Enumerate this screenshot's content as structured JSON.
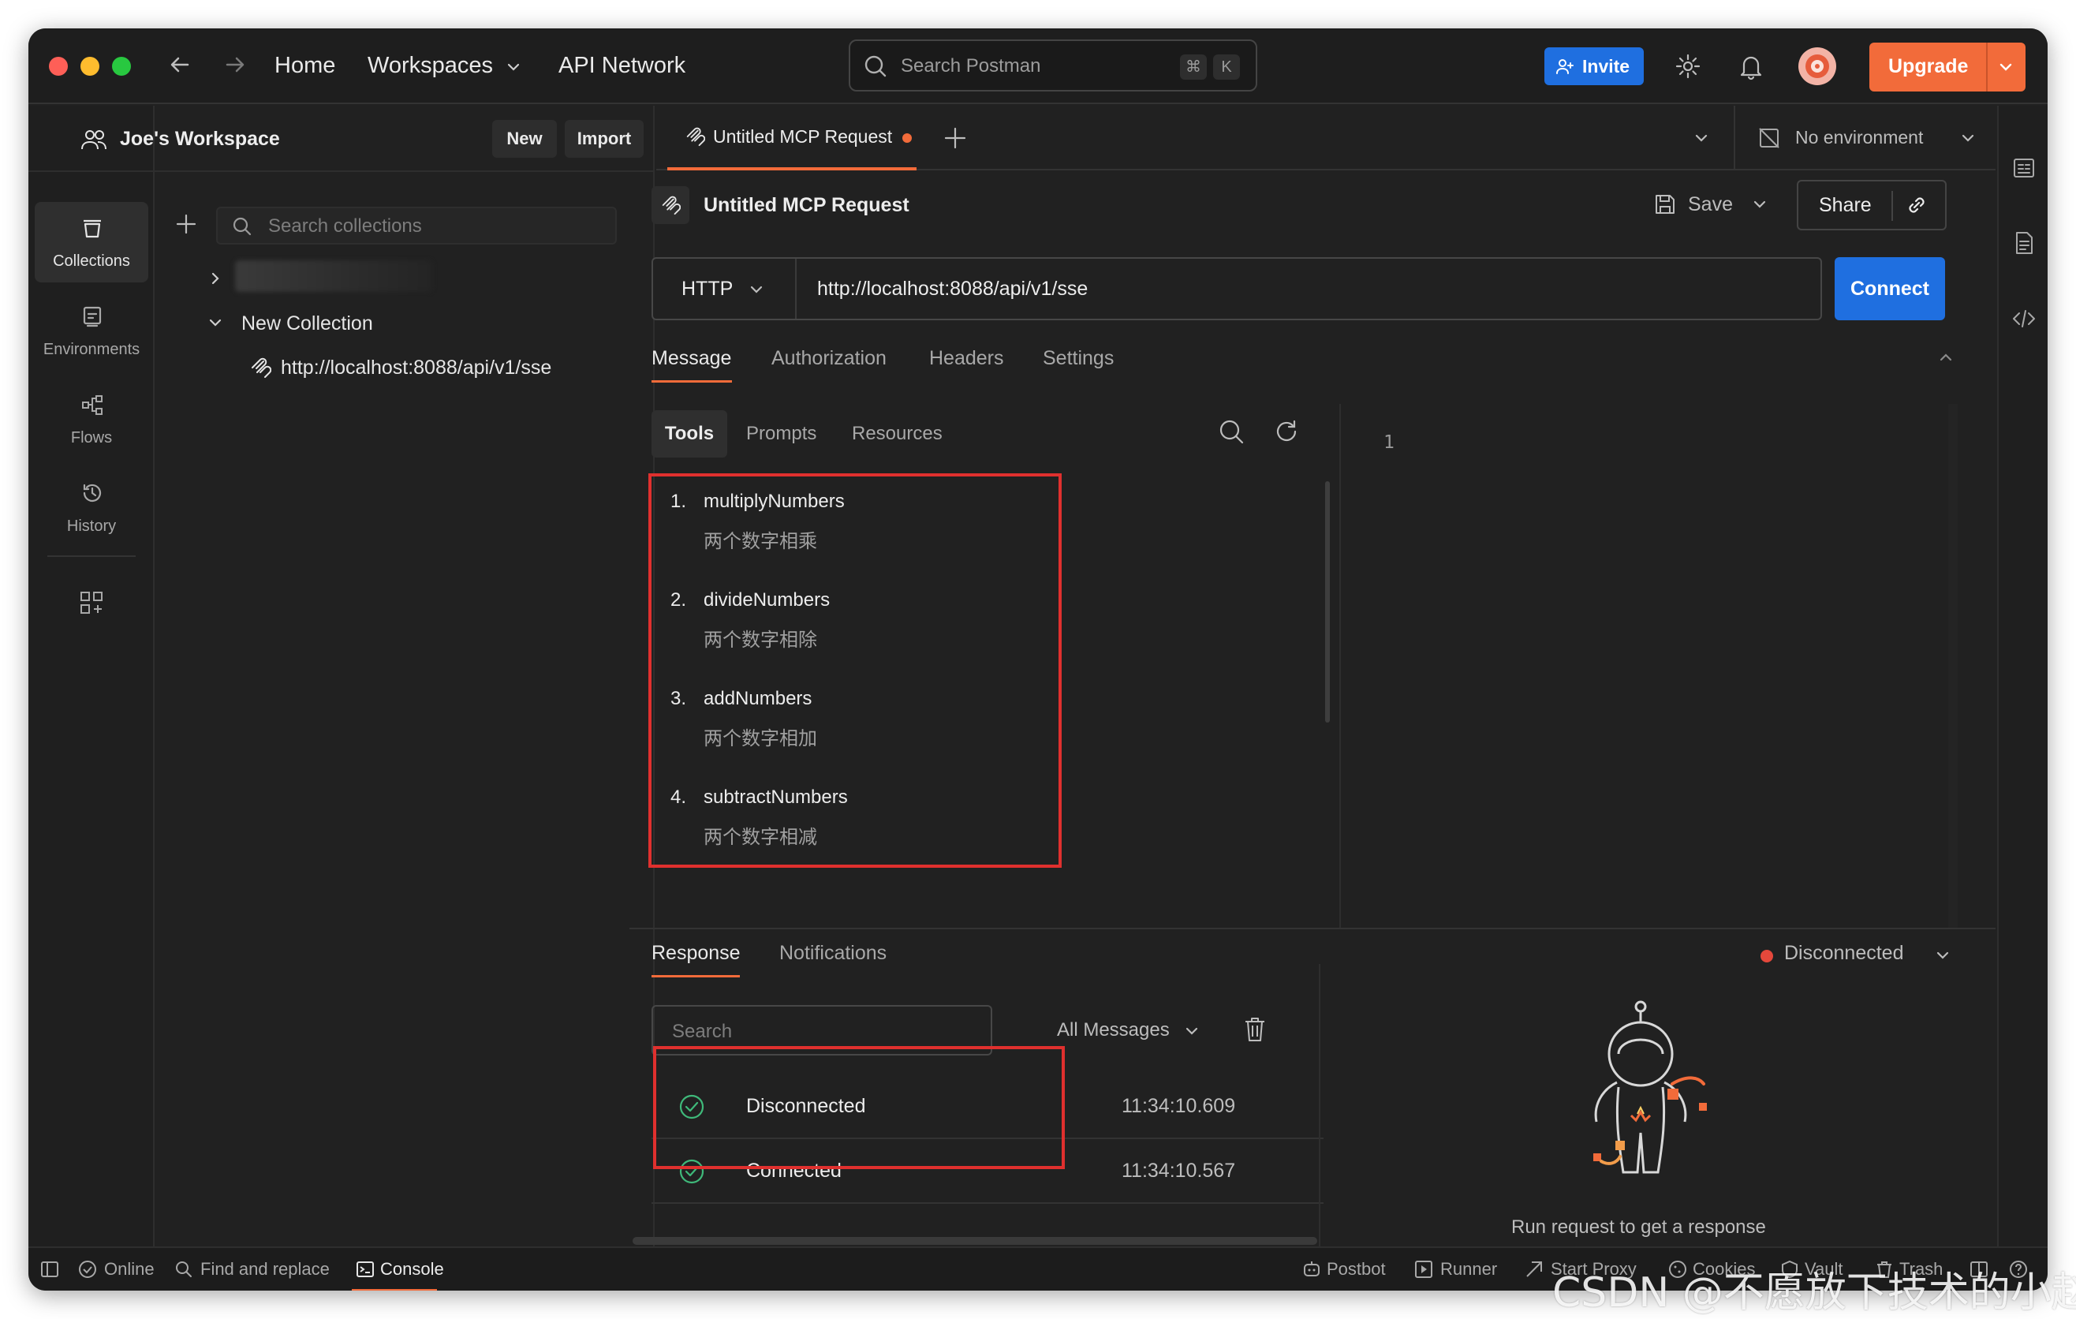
{
  "titlebar": {
    "home": "Home",
    "workspaces": "Workspaces",
    "api_network": "API Network",
    "search_placeholder": "Search Postman",
    "shortcut_cmd": "⌘",
    "shortcut_key": "K",
    "invite": "Invite",
    "upgrade": "Upgrade"
  },
  "rail": {
    "items": [
      {
        "label": "Collections",
        "icon": "collections-icon",
        "active": true
      },
      {
        "label": "Environments",
        "icon": "environments-icon",
        "active": false
      },
      {
        "label": "Flows",
        "icon": "flows-icon",
        "active": false
      },
      {
        "label": "History",
        "icon": "history-icon",
        "active": false
      }
    ]
  },
  "sidebar": {
    "workspace_name": "Joe's Workspace",
    "new_label": "New",
    "import_label": "Import",
    "search_placeholder": "Search collections",
    "collection_name": "New Collection",
    "request_url": "http://localhost:8088/api/v1/sse"
  },
  "tabbar": {
    "tab_title": "Untitled MCP Request",
    "environment": "No environment"
  },
  "request": {
    "title": "Untitled MCP Request",
    "save_label": "Save",
    "share_label": "Share",
    "method": "HTTP",
    "url": "http://localhost:8088/api/v1/sse",
    "connect_label": "Connect",
    "tabs": [
      "Message",
      "Authorization",
      "Headers",
      "Settings"
    ],
    "active_tab": "Message"
  },
  "message": {
    "subtabs": [
      "Tools",
      "Prompts",
      "Resources"
    ],
    "active_subtab": "Tools",
    "tools": [
      {
        "num": "1.",
        "name": "multiplyNumbers",
        "desc": "两个数字相乘"
      },
      {
        "num": "2.",
        "name": "divideNumbers",
        "desc": "两个数字相除"
      },
      {
        "num": "3.",
        "name": "addNumbers",
        "desc": "两个数字相加"
      },
      {
        "num": "4.",
        "name": "subtractNumbers",
        "desc": "两个数字相减"
      }
    ],
    "editor_line": "1"
  },
  "response": {
    "tabs": [
      "Response",
      "Notifications"
    ],
    "active_tab": "Response",
    "status": "Disconnected",
    "search_placeholder": "Search",
    "filter": "All Messages",
    "messages": [
      {
        "text": "Disconnected",
        "time": "11:34:10.609"
      },
      {
        "text": "Connected",
        "time": "11:34:10.567"
      }
    ],
    "empty_text": "Run request to get a response"
  },
  "statusbar": {
    "online": "Online",
    "find_replace": "Find and replace",
    "console": "Console",
    "postbot": "Postbot",
    "runner": "Runner",
    "start_proxy": "Start Proxy",
    "cookies": "Cookies",
    "vault": "Vault",
    "trash": "Trash"
  },
  "watermark": "CSDN @不愿放下技术的小赵",
  "colors": {
    "accent_blue": "#1f6fe0",
    "upgrade_orange": "#f26b3a",
    "highlight_red": "#e0302e",
    "status_red": "#e5483b",
    "check_green": "#3fb97a"
  }
}
